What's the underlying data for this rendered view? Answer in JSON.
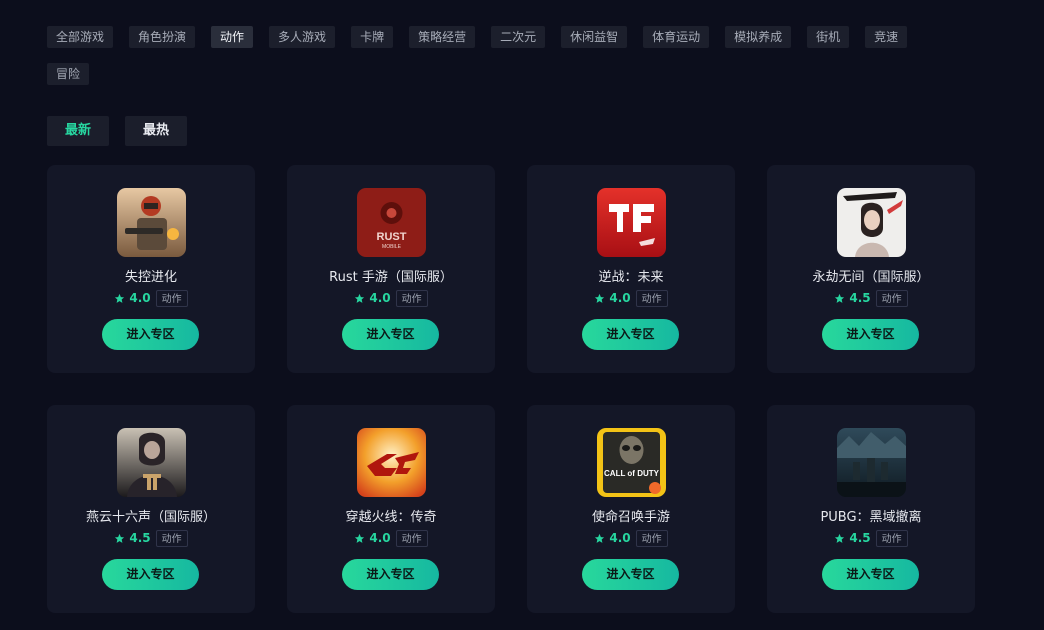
{
  "categories": [
    {
      "label": "全部游戏"
    },
    {
      "label": "角色扮演"
    },
    {
      "label": "动作",
      "active": true
    },
    {
      "label": "多人游戏"
    },
    {
      "label": "卡牌"
    },
    {
      "label": "策略经营"
    },
    {
      "label": "二次元"
    },
    {
      "label": "休闲益智"
    },
    {
      "label": "体育运动"
    },
    {
      "label": "模拟养成"
    },
    {
      "label": "街机"
    },
    {
      "label": "竞速"
    },
    {
      "label": "冒险"
    }
  ],
  "sort_tabs": [
    {
      "label": "最新",
      "active": true
    },
    {
      "label": "最热"
    }
  ],
  "accent_color": "#27d6a0",
  "games": [
    {
      "name": "失控进化",
      "rating": "4.0",
      "tag": "动作",
      "button": "进入专区",
      "icon": "out-of-control-game-icon"
    },
    {
      "name": "Rust 手游（国际服）",
      "rating": "4.0",
      "tag": "动作",
      "button": "进入专区",
      "icon": "rust-mobile-game-icon",
      "icon_text": "RUST",
      "icon_subtext": "MOBILE"
    },
    {
      "name": "逆战：未来",
      "rating": "4.0",
      "tag": "动作",
      "button": "进入专区",
      "icon": "nizhan-future-game-icon"
    },
    {
      "name": "永劫无间（国际服）",
      "rating": "4.5",
      "tag": "动作",
      "button": "进入专区",
      "icon": "naraka-game-icon"
    },
    {
      "name": "燕云十六声（国际服）",
      "rating": "4.5",
      "tag": "动作",
      "button": "进入专区",
      "icon": "where-winds-meet-game-icon"
    },
    {
      "name": "穿越火线：传奇",
      "rating": "4.0",
      "tag": "动作",
      "button": "进入专区",
      "icon": "crossfire-game-icon"
    },
    {
      "name": "使命召唤手游",
      "rating": "4.0",
      "tag": "动作",
      "button": "进入专区",
      "icon": "call-of-duty-game-icon",
      "icon_text": "CALL of DUTY"
    },
    {
      "name": "PUBG：黑域撤离",
      "rating": "4.5",
      "tag": "动作",
      "button": "进入专区",
      "icon": "pubg-black-budget-game-icon"
    }
  ]
}
